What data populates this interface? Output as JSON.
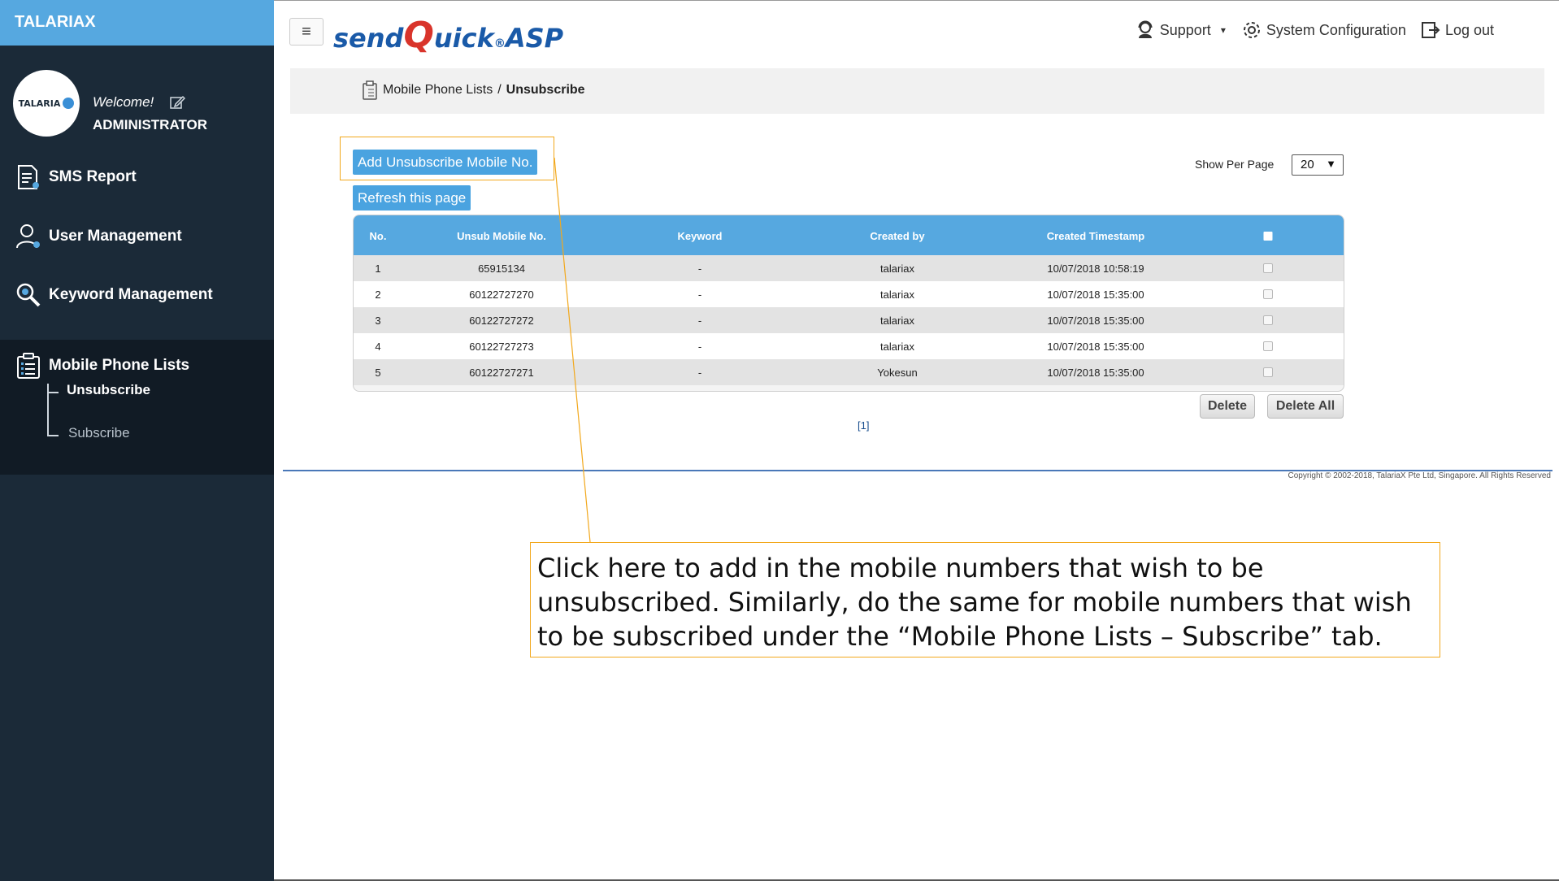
{
  "sidebar": {
    "brand": "TALARIAX",
    "avatar_logo": "TALARIA",
    "welcome": "Welcome!",
    "user_name": "ADMINISTRATOR",
    "nav": {
      "sms_report": "SMS Report",
      "user_management": "User Management",
      "keyword_management": "Keyword Management",
      "mobile_phone_lists": "Mobile Phone Lists"
    },
    "sub_items": {
      "unsubscribe": "Unsubscribe",
      "subscribe": "Subscribe"
    }
  },
  "header": {
    "menu_icon": "≡",
    "logo_send": "send",
    "logo_q": "Q",
    "logo_uick": "uick",
    "logo_reg": "®",
    "logo_asp": " ASP",
    "support": "Support",
    "support_caret": "▾",
    "system_configuration": "System Configuration",
    "log_out": "Log out"
  },
  "breadcrumb": {
    "parent": "Mobile Phone Lists",
    "separator": "/",
    "current": "Unsubscribe"
  },
  "actions": {
    "add_button": "Add Unsubscribe Mobile No.",
    "refresh_button": "Refresh this page",
    "show_per_page_label": "Show Per Page",
    "show_per_page_value": "20",
    "select_arrow": "▼",
    "delete_button": "Delete",
    "delete_all_button": "Delete All",
    "pagination": "[1]"
  },
  "table": {
    "headers": {
      "no": "No.",
      "mobile": "Unsub Mobile No.",
      "keyword": "Keyword",
      "created_by": "Created by",
      "timestamp": "Created Timestamp"
    },
    "rows": [
      {
        "no": "1",
        "mobile": "65915134",
        "keyword": "-",
        "created_by": "talariax",
        "timestamp": "10/07/2018 10:58:19"
      },
      {
        "no": "2",
        "mobile": "60122727270",
        "keyword": "-",
        "created_by": "talariax",
        "timestamp": "10/07/2018 15:35:00"
      },
      {
        "no": "3",
        "mobile": "60122727272",
        "keyword": "-",
        "created_by": "talariax",
        "timestamp": "10/07/2018 15:35:00"
      },
      {
        "no": "4",
        "mobile": "60122727273",
        "keyword": "-",
        "created_by": "talariax",
        "timestamp": "10/07/2018 15:35:00"
      },
      {
        "no": "5",
        "mobile": "60122727271",
        "keyword": "-",
        "created_by": "Yokesun",
        "timestamp": "10/07/2018 15:35:00"
      }
    ]
  },
  "footer": {
    "copyright": "Copyright © 2002-2018, TalariaX Pte Ltd, Singapore. All Rights Reserved"
  },
  "callout": {
    "text": "Click here to add in the mobile numbers that wish to be unsubscribed. Similarly, do the same for mobile numbers that wish to be subscribed under the “Mobile Phone Lists – Subscribe” tab."
  },
  "colors": {
    "sidebar_bg": "#1b2a38",
    "accent_blue": "#56a8e0",
    "highlight_orange": "#f2a81c"
  }
}
